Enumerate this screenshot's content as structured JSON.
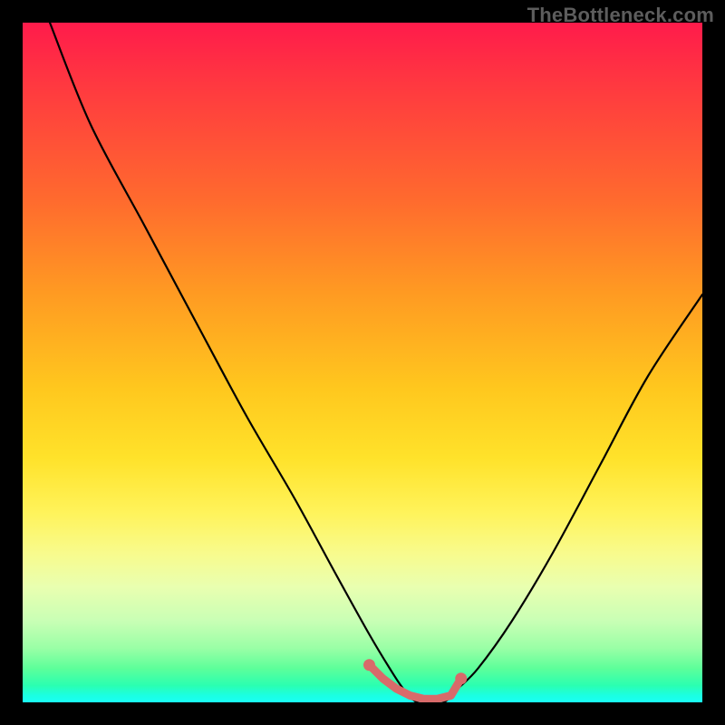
{
  "watermark": "TheBottleneck.com",
  "chart_data": {
    "type": "line",
    "title": "",
    "xlabel": "",
    "ylabel": "",
    "xlim": [
      0,
      100
    ],
    "ylim": [
      0,
      100
    ],
    "grid": false,
    "series": [
      {
        "name": "bottleneck-curve",
        "x": [
          4,
          10,
          18,
          26,
          33,
          40,
          46,
          51,
          54,
          56,
          58,
          60,
          62,
          64,
          67,
          72,
          78,
          85,
          92,
          100
        ],
        "values": [
          100,
          85,
          70,
          55,
          42,
          30,
          19,
          10,
          5,
          2,
          0,
          0,
          0,
          2,
          5,
          12,
          22,
          35,
          48,
          60
        ]
      }
    ],
    "trough_markers": {
      "name": "trough-highlight",
      "x": [
        51,
        53,
        55,
        57,
        59,
        61,
        63,
        64.5
      ],
      "values": [
        5.5,
        3.5,
        2,
        1,
        0.5,
        0.5,
        1,
        3.5
      ],
      "color": "#d86a6a"
    },
    "gradient_stops": [
      {
        "pos": 0,
        "color": "#ff1b4b"
      },
      {
        "pos": 0.55,
        "color": "#ffd21e"
      },
      {
        "pos": 0.82,
        "color": "#f5ff80"
      },
      {
        "pos": 1.0,
        "color": "#19fff0"
      }
    ]
  }
}
